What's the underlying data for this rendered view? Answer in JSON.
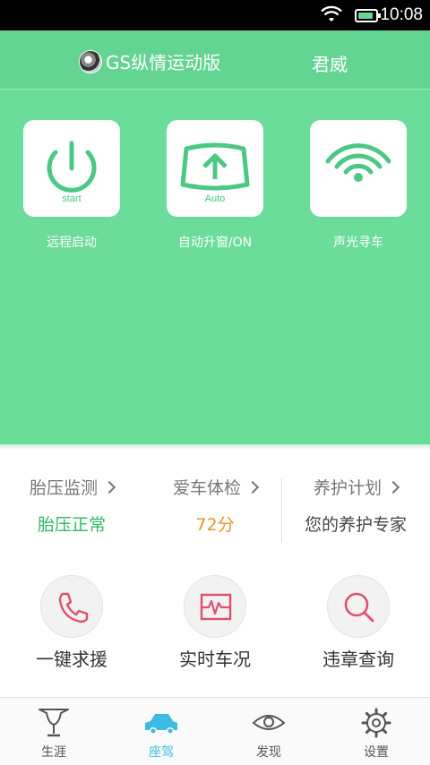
{
  "status_bar": {
    "time": "10:08",
    "icons": [
      "wifi-icon",
      "battery-icon"
    ]
  },
  "header": {
    "car_model": "GS纵情运动版",
    "brand": "君威"
  },
  "actions": [
    {
      "label": "远程启动",
      "tile_text": "start",
      "icon": "power-icon"
    },
    {
      "label": "自动升窗/ON",
      "tile_text": "Auto",
      "icon": "window-up-icon"
    },
    {
      "label": "声光寻车",
      "tile_text": "",
      "icon": "signal-icon"
    }
  ],
  "info": [
    {
      "title": "胎压监测",
      "value": "胎压正常"
    },
    {
      "title": "爱车体检",
      "value": "72分"
    },
    {
      "title": "养护计划",
      "value": "您的养护专家"
    }
  ],
  "services": [
    {
      "label": "一键求援",
      "icon": "phone-icon"
    },
    {
      "label": "实时车况",
      "icon": "heartbeat-monitor-icon"
    },
    {
      "label": "违章查询",
      "icon": "search-icon"
    }
  ],
  "nav": [
    {
      "label": "生涯",
      "icon": "trophy-icon"
    },
    {
      "label": "座驾",
      "icon": "car-icon",
      "active": true
    },
    {
      "label": "发现",
      "icon": "eye-icon"
    },
    {
      "label": "设置",
      "icon": "gear-icon"
    }
  ],
  "colors": {
    "primary_green": "#6bdc99",
    "active_blue": "#3ebbe2",
    "accent_orange": "#e6962a",
    "ok_green": "#2fb865",
    "icon_pink": "#e0506e"
  }
}
